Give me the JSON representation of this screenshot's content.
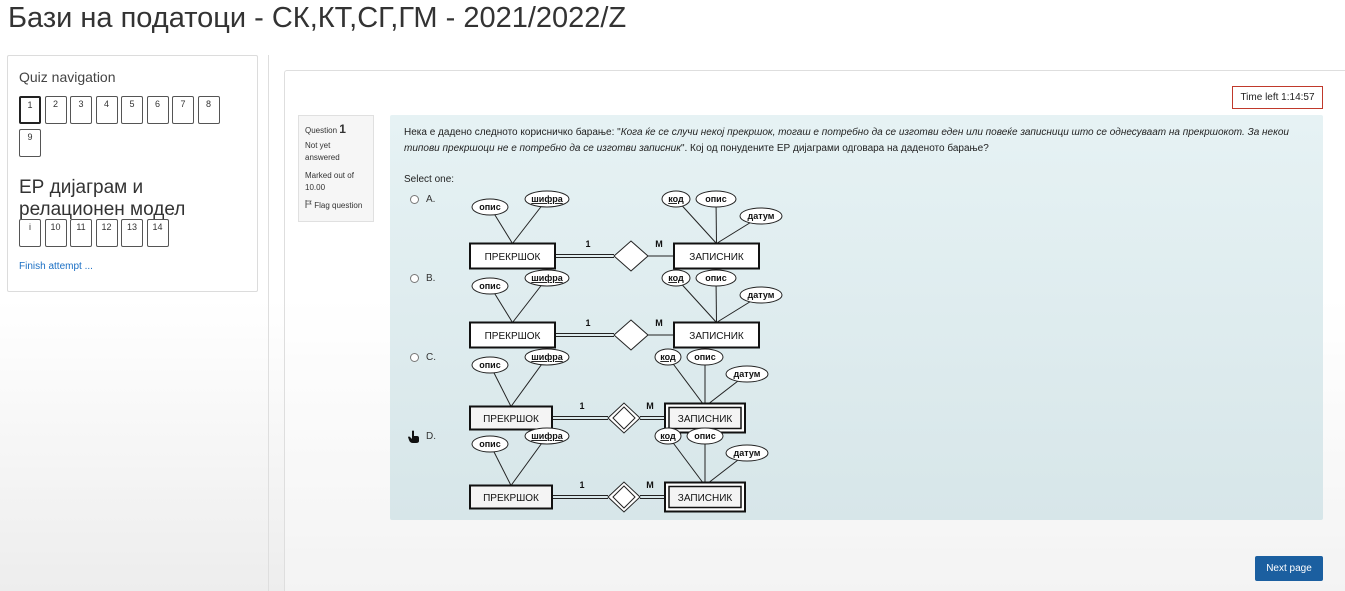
{
  "page_title": "Бази на податоци - СК,КТ,СГ,ГМ - 2021/2022/Z",
  "nav": {
    "title": "Quiz navigation",
    "buttons_row1": [
      "1",
      "2",
      "3",
      "4",
      "5",
      "6",
      "7",
      "8"
    ],
    "buttons_row2": [
      "9"
    ],
    "section_title": "ЕР дијаграм и релационен модел",
    "buttons_row3": [
      "i",
      "10",
      "11",
      "12",
      "13",
      "14"
    ],
    "finish_label": "Finish attempt ..."
  },
  "timer": "Time left 1:14:57",
  "question_info": {
    "label": "Question",
    "number": "1",
    "state": "Not yet answered",
    "grade": "Marked out of 10.00",
    "flag_label": "Flag question"
  },
  "question": {
    "text_prefix": "Нека е дадено следното корисничко барање: \"",
    "text_italic": "Кога ќе се случи некој прекршок, тогаш е потребно да се изготви еден или повеќе записници што се однесуваат на прекршокот. За некои типови прекршоци не е потребно да се изготви записник",
    "text_suffix": "\". Кој од понудените ЕР дијаграми одговара на даденото барање?",
    "select_label": "Select one:",
    "options": [
      {
        "label": "A."
      },
      {
        "label": "B."
      },
      {
        "label": "C."
      },
      {
        "label": "D."
      }
    ],
    "erd": {
      "entity1": "ПРЕКРШОК",
      "entity2": "ЗАПИСНИК",
      "e1_attrs": [
        "опис",
        "шифра"
      ],
      "e2_attrs": [
        "код",
        "опис",
        "датум"
      ],
      "card1": "1",
      "card2": "M"
    }
  },
  "next_label": "Next page",
  "icons": {
    "flag": "flag-icon",
    "cursor": "hand-cursor-icon"
  }
}
